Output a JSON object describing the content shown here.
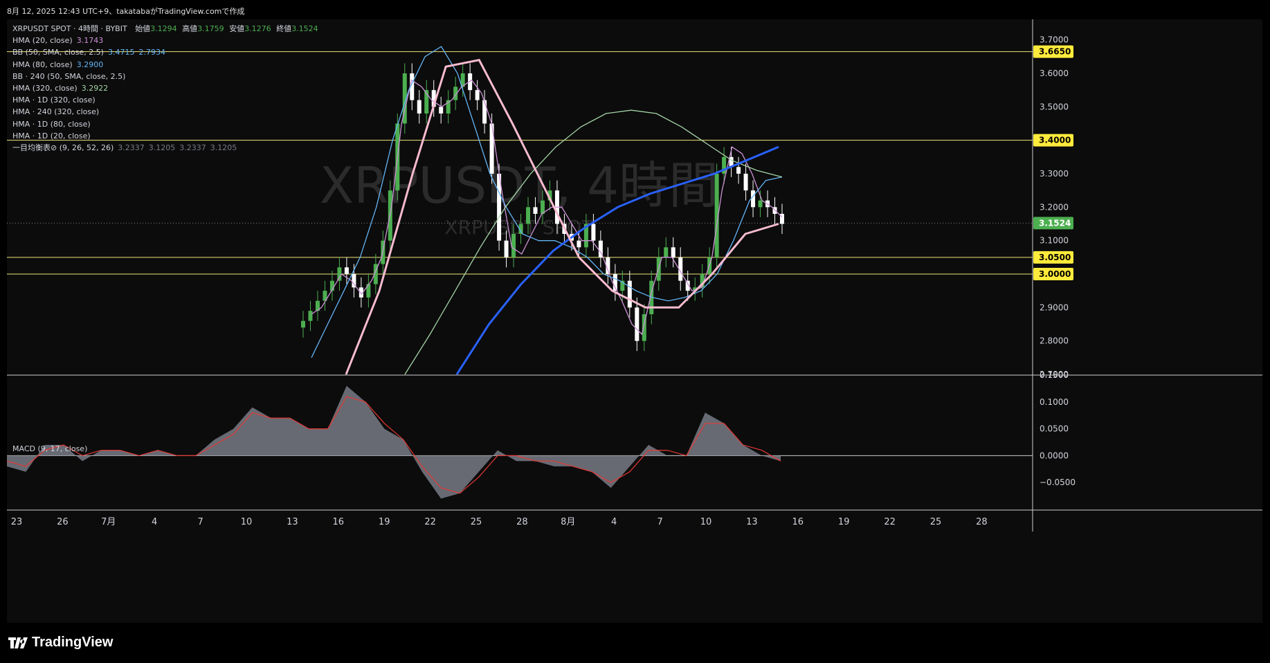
{
  "header": {
    "text": "8月 12, 2025 12:43 UTC+9、takatabaがTradingView.comで作成"
  },
  "legend": {
    "symbol": "XRPUSDT SPOT · 4時間 · BYBIT",
    "open_label": "始値",
    "open": "3.1294",
    "high_label": "高値",
    "high": "3.1759",
    "low_label": "安値",
    "low": "3.1276",
    "close_label": "終値",
    "close": "3.1524",
    "rows": [
      {
        "label": "HMA (20, close)",
        "value": "3.1743",
        "color": "#ce93d8"
      },
      {
        "label": "BB (50, SMA, close, 2.5)",
        "value": "3.4715",
        "value2": "2.7934",
        "color": "#64b5f6"
      },
      {
        "label": "HMA (80, close)",
        "value": "3.2900",
        "color": "#64b5f6"
      },
      {
        "label": "BB · 240 (50, SMA, close, 2.5)",
        "value": "",
        "color": ""
      },
      {
        "label": "HMA (320, close)",
        "value": "3.2922",
        "color": "#a5d6a7"
      },
      {
        "label": "HMA · 1D (320, close)",
        "value": "",
        "color": ""
      },
      {
        "label": "HMA · 240 (320, close)",
        "value": "",
        "color": ""
      },
      {
        "label": "HMA · 1D (80, close)",
        "value": "",
        "color": ""
      },
      {
        "label": "HMA · 1D (20, close)",
        "value": "",
        "color": ""
      },
      {
        "label": "一目均衡表⊘ (9, 26, 52, 26)",
        "value": "3.2337",
        "value2": "3.1205",
        "value3": "3.2337",
        "value4": "3.1205",
        "color": "#787b86"
      }
    ]
  },
  "watermark": {
    "big": "XRPUSDT, 4時間",
    "small": "XRPUSDT SPOT"
  },
  "macd_label": "MACD (9, 17, close)",
  "footer_logo": "TradingView",
  "colors": {
    "up": "#4caf50",
    "down": "#ffffff",
    "hline": "#f0e67a",
    "last": "#4caf50"
  },
  "chart_data": {
    "type": "line",
    "price_axis": {
      "ticks": [
        "3.7000",
        "3.6000",
        "3.5000",
        "3.3000",
        "3.2000",
        "3.1000",
        "2.9000",
        "2.8000",
        "2.7000"
      ],
      "ylim": [
        2.7,
        3.72
      ]
    },
    "price_labels": [
      {
        "value": 3.665,
        "text": "3.6650",
        "kind": "hline"
      },
      {
        "value": 3.4,
        "text": "3.4000",
        "kind": "hline"
      },
      {
        "value": 3.1524,
        "text": "3.1524",
        "kind": "last"
      },
      {
        "value": 3.05,
        "text": "3.0500",
        "kind": "hline"
      },
      {
        "value": 3.0,
        "text": "3.0000",
        "kind": "hline"
      }
    ],
    "x_ticks": [
      "23",
      "26",
      "7月",
      "4",
      "7",
      "10",
      "13",
      "16",
      "19",
      "22",
      "25",
      "28",
      "8月",
      "4",
      "7",
      "10",
      "13",
      "16",
      "19",
      "22",
      "25",
      "28"
    ],
    "macd_axis": {
      "ticks": [
        "0.1500",
        "0.1000",
        "0.0500",
        "0.0000",
        "−0.0500"
      ],
      "ylim": [
        -0.1,
        0.15
      ]
    },
    "candles_close": [
      2.86,
      2.89,
      2.92,
      2.95,
      2.98,
      3.02,
      3.0,
      2.96,
      2.93,
      2.97,
      3.03,
      3.1,
      3.25,
      3.45,
      3.6,
      3.52,
      3.48,
      3.55,
      3.5,
      3.48,
      3.52,
      3.56,
      3.6,
      3.55,
      3.52,
      3.45,
      3.3,
      3.1,
      3.05,
      3.12,
      3.15,
      3.2,
      3.18,
      3.22,
      3.25,
      3.15,
      3.12,
      3.1,
      3.08,
      3.15,
      3.1,
      3.05,
      3.0,
      2.95,
      2.98,
      2.9,
      2.8,
      2.88,
      2.98,
      3.05,
      3.08,
      3.05,
      2.98,
      2.95,
      2.96,
      3.0,
      3.05,
      3.3,
      3.35,
      3.32,
      3.3,
      3.25,
      3.2,
      3.22,
      3.2,
      3.18,
      3.15
    ],
    "series": [
      {
        "name": "HMA (20, close)",
        "color": "#ce93d8",
        "values": [
          2.88,
          2.9,
          2.95,
          3.0,
          2.98,
          2.94,
          2.98,
          3.05,
          3.2,
          3.45,
          3.58,
          3.56,
          3.52,
          3.5,
          3.52,
          3.56,
          3.58,
          3.54,
          3.45,
          3.25,
          3.08,
          3.06,
          3.12,
          3.18,
          3.2,
          3.2,
          3.15,
          3.1,
          3.1,
          3.06,
          2.98,
          2.92,
          2.85,
          2.82,
          2.95,
          3.05,
          3.05,
          3.0,
          2.95,
          2.96,
          3.05,
          3.25,
          3.38,
          3.36,
          3.3,
          3.22,
          3.2,
          3.17
        ]
      },
      {
        "name": "HMA (80, close)",
        "color": "#64b5f6",
        "values": [
          2.75,
          2.85,
          2.95,
          3.05,
          3.2,
          3.4,
          3.55,
          3.65,
          3.68,
          3.6,
          3.45,
          3.3,
          3.2,
          3.12,
          3.1,
          3.1,
          3.08,
          3.05,
          3.0,
          2.98,
          2.95,
          2.93,
          2.92,
          2.93,
          2.95,
          3.0,
          3.1,
          3.22,
          3.28,
          3.29
        ]
      },
      {
        "name": "HMA (320, close)",
        "color": "#a5d6a7",
        "values": [
          2.7,
          2.82,
          2.95,
          3.08,
          3.2,
          3.3,
          3.38,
          3.44,
          3.48,
          3.49,
          3.48,
          3.44,
          3.39,
          3.34,
          3.31,
          3.29
        ]
      },
      {
        "name": "HMA · 1D (80, close)",
        "color": "#2962ff",
        "values": [
          2.7,
          2.85,
          2.97,
          3.07,
          3.14,
          3.2,
          3.24,
          3.27,
          3.3,
          3.34,
          3.38
        ]
      },
      {
        "name": "HMA · 1D (20, close)",
        "color": "#f8bbd0",
        "values": [
          2.7,
          2.95,
          3.3,
          3.62,
          3.64,
          3.45,
          3.25,
          3.05,
          2.95,
          2.9,
          2.9,
          3.0,
          3.12,
          3.15
        ]
      }
    ],
    "macd": {
      "hist": [
        -0.02,
        -0.03,
        0.02,
        0.02,
        -0.01,
        0.01,
        0.01,
        0.0,
        0.01,
        0.0,
        0.0,
        0.03,
        0.05,
        0.09,
        0.07,
        0.07,
        0.05,
        0.05,
        0.13,
        0.1,
        0.05,
        0.03,
        -0.03,
        -0.08,
        -0.07,
        -0.03,
        0.01,
        -0.01,
        -0.01,
        -0.02,
        -0.02,
        -0.03,
        -0.06,
        -0.02,
        0.02,
        0.0,
        0.0,
        0.08,
        0.06,
        0.02,
        0.0,
        -0.01
      ],
      "signal": [
        -0.01,
        -0.02,
        0.01,
        0.02,
        0.0,
        0.01,
        0.01,
        0.0,
        0.01,
        0.0,
        0.0,
        0.02,
        0.04,
        0.08,
        0.07,
        0.07,
        0.05,
        0.05,
        0.11,
        0.1,
        0.06,
        0.03,
        -0.02,
        -0.06,
        -0.07,
        -0.04,
        0.0,
        0.0,
        -0.01,
        -0.01,
        -0.02,
        -0.03,
        -0.05,
        -0.03,
        0.01,
        0.01,
        0.0,
        0.06,
        0.06,
        0.02,
        0.01,
        -0.01
      ]
    }
  }
}
